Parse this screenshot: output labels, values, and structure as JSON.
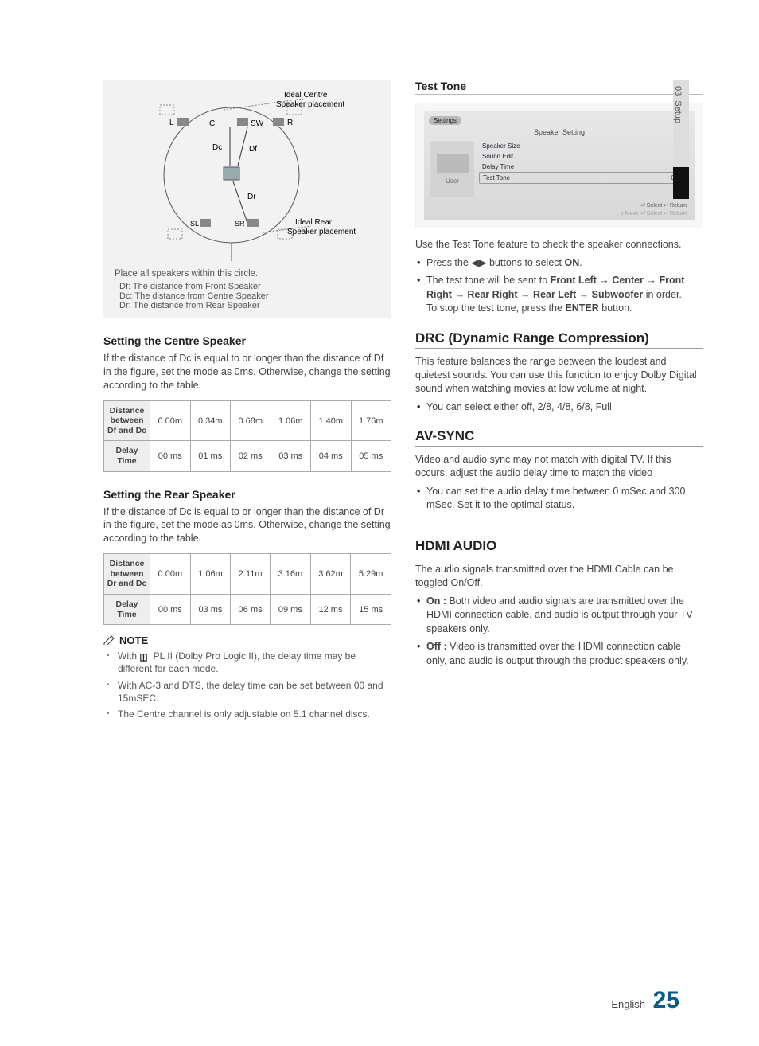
{
  "sideTab": {
    "chapter": "03",
    "title": "Setup"
  },
  "diagram": {
    "idealCentre": "Ideal Centre\nSpeaker placement",
    "idealRear": "Ideal Rear\nSpeaker placement",
    "labels": {
      "L": "L",
      "R": "R",
      "C": "C",
      "SW": "SW",
      "SL": "SL",
      "SR": "SR",
      "Dc": "Dc",
      "Df": "Df",
      "Dr": "Dr"
    },
    "caption": "Place all speakers within this circle.",
    "defDf": "Df: The distance from Front Speaker",
    "defDc": "Dc: The distance from Centre Speaker",
    "defDr": "Dr: The distance from Rear Speaker"
  },
  "centre": {
    "heading": "Setting the Centre Speaker",
    "intro": "If the distance of Dc is equal to or longer than the distance of Df in the figure, set the mode as 0ms. Otherwise, change the setting according to the table.",
    "rowLabelDist": "Distance between Df and Dc",
    "rowLabelDelay": "Delay Time",
    "dist": [
      "0.00m",
      "0.34m",
      "0.68m",
      "1.06m",
      "1.40m",
      "1.76m"
    ],
    "delay": [
      "00 ms",
      "01 ms",
      "02 ms",
      "03 ms",
      "04 ms",
      "05 ms"
    ]
  },
  "rear": {
    "heading": "Setting the Rear Speaker",
    "intro": "If the distance of Dc is equal to or longer than the distance of Dr in the figure, set the mode as 0ms. Otherwise, change the setting according to the table.",
    "rowLabelDist": "Distance between Dr and Dc",
    "rowLabelDelay": "Delay Time",
    "dist": [
      "0.00m",
      "1.06m",
      "2.11m",
      "3.16m",
      "3.62m",
      "5.29m"
    ],
    "delay": [
      "00 ms",
      "03 ms",
      "06 ms",
      "09 ms",
      "12 ms",
      "15 ms"
    ]
  },
  "noteHead": "NOTE",
  "notes": {
    "n1a": "With ",
    "n1b": " PL II (Dolby Pro Logic II), the delay time may be different for each mode.",
    "n2": "With AC-3 and DTS, the delay time can be set between 00 and 15mSEC.",
    "n3": "The Centre channel is only adjustable on 5.1 channel discs."
  },
  "testTone": {
    "heading": "Test Tone",
    "osd": {
      "crumb": "Settings",
      "title": "Speaker Setting",
      "leftLabel": "User",
      "rows": {
        "r1": "Speaker Size",
        "r2": "Sound Edit",
        "r3": "Delay Time",
        "r4name": "Test Tone",
        "r4val": ":   On     ▸"
      },
      "foot1": "⏎ Select     ↩ Return",
      "foot2": "↕ Move    ⏎ Select    ↩ Return"
    },
    "p1": "Use the Test Tone feature to check the speaker connections.",
    "b1a": "Press the ◀▶ buttons to select ",
    "b1b": "ON",
    "b1c": ".",
    "b2a": "The test tone will be sent to ",
    "b2seq": "Front Left → Center → Front Right → Rear Right → Rear Left → Subwoofer",
    "b2b": " in order.",
    "b2c": "To stop the test tone, press the ",
    "b2d": "ENTER",
    "b2e": " button."
  },
  "drc": {
    "heading": "DRC (Dynamic Range Compression)",
    "p1": "This feature balances the range between the loudest and quietest sounds. You can use this function to enjoy Dolby Digital sound when watching movies at low volume at night.",
    "b1": "You can select either off, 2/8, 4/8, 6/8, Full"
  },
  "avsync": {
    "heading": "AV-SYNC",
    "p1": "Video and audio sync may not match with digital TV. If this occurs, adjust the audio delay time to match the video",
    "b1": "You can set the audio delay time between 0 mSec and 300 mSec. Set it to the optimal status."
  },
  "hdmi": {
    "heading": "HDMI AUDIO",
    "p1": "The audio signals transmitted over the HDMI Cable can be toggled On/Off.",
    "onLabel": "On : ",
    "onText": "Both video and audio signals are transmitted over the HDMI connection cable, and audio is output through your TV speakers only.",
    "offLabel": "Off : ",
    "offText": "Video is transmitted over the HDMI connection cable only, and audio is output through the product speakers only."
  },
  "footer": {
    "lang": "English",
    "page": "25"
  }
}
